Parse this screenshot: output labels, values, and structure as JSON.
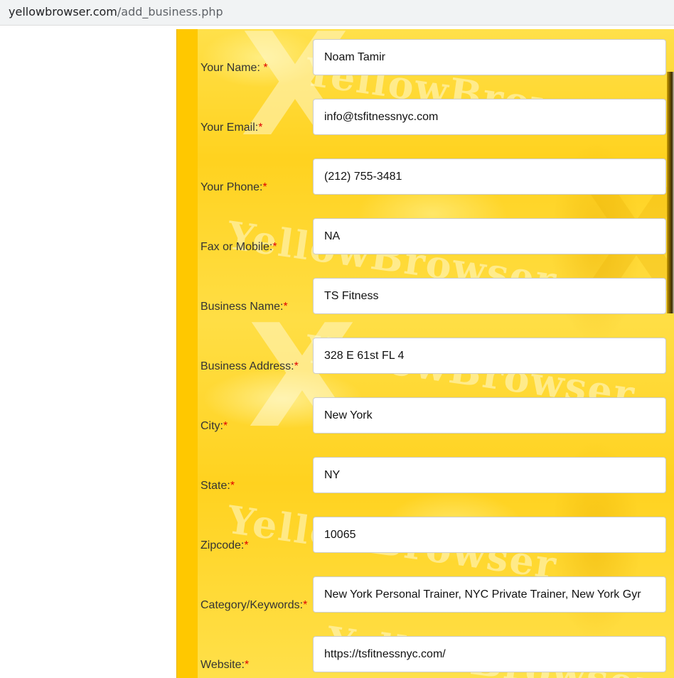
{
  "browser": {
    "url_domain": "yellowbrowser.com",
    "url_path": "/add_business.php"
  },
  "form": {
    "required_mark": "*",
    "fields": [
      {
        "label": "Your Name: ",
        "value": "Noam Tamir"
      },
      {
        "label": "Your Email:",
        "value": "info@tsfitnessnyc.com"
      },
      {
        "label": "Your Phone:",
        "value": "(212) 755-3481"
      },
      {
        "label": "Fax or Mobile:",
        "value": "NA"
      },
      {
        "label": "Business Name:",
        "value": "TS Fitness"
      },
      {
        "label": "Business Address:",
        "value": "328 E 61st FL 4"
      },
      {
        "label": "City:",
        "value": "New York"
      },
      {
        "label": "State:",
        "value": "NY"
      },
      {
        "label": "Zipcode:",
        "value": "10065"
      },
      {
        "label": "Category/Keywords:",
        "value": "New York Personal Trainer, NYC Private Trainer, New York Gyr"
      },
      {
        "label": "Website:",
        "value": "https://tsfitnessnyc.com/"
      }
    ]
  },
  "background": {
    "watermark_text": "YellowBrowser",
    "colors": {
      "yellow": "#ffd21f",
      "strip": "#ffc800",
      "required": "#e00000"
    }
  }
}
